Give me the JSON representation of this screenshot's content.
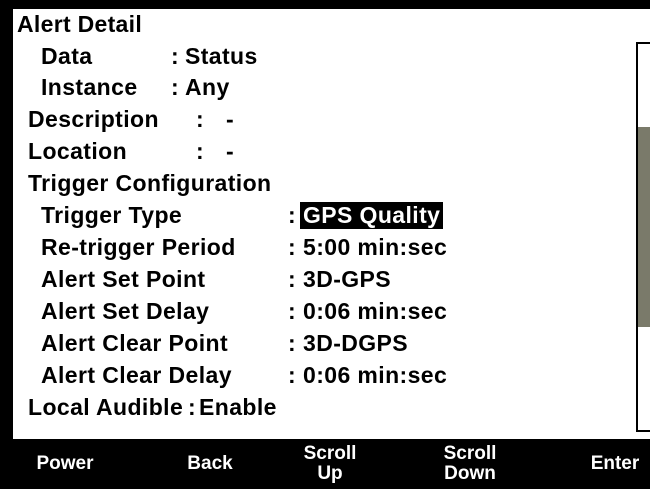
{
  "title": "Alert Detail",
  "rows": [
    {
      "label": "Data",
      "sep": ":",
      "value": "Status"
    },
    {
      "label": "Instance",
      "sep": ":",
      "value": "Any"
    },
    {
      "label": "Description",
      "sep": ":",
      "value": "-"
    },
    {
      "label": "Location",
      "sep": ":",
      "value": "-"
    },
    {
      "label": "Trigger Configuration",
      "sep": "",
      "value": ""
    },
    {
      "label": "Trigger Type",
      "sep": ":",
      "value": "GPS Quality"
    },
    {
      "label": "Re-trigger Period",
      "sep": ":",
      "value": "5:00 min:sec"
    },
    {
      "label": "Alert Set Point",
      "sep": ":",
      "value": "3D-GPS"
    },
    {
      "label": "Alert Set Delay",
      "sep": ":",
      "value": "0:06 min:sec"
    },
    {
      "label": "Alert Clear Point",
      "sep": ":",
      "value": "3D-DGPS"
    },
    {
      "label": "Alert Clear Delay",
      "sep": ":",
      "value": "0:06 min:sec"
    },
    {
      "label": "Local Audible",
      "sep": ":",
      "value": "Enable"
    }
  ],
  "softkeys": {
    "power": "Power",
    "back": "Back",
    "scroll_up": "Scroll\nUp",
    "scroll_down": "Scroll\nDown",
    "enter": "Enter"
  },
  "colors": {
    "background": "#ffffff",
    "bezel": "#000000",
    "highlight": "#000000",
    "scroll_thumb": "#7a7a6a"
  }
}
